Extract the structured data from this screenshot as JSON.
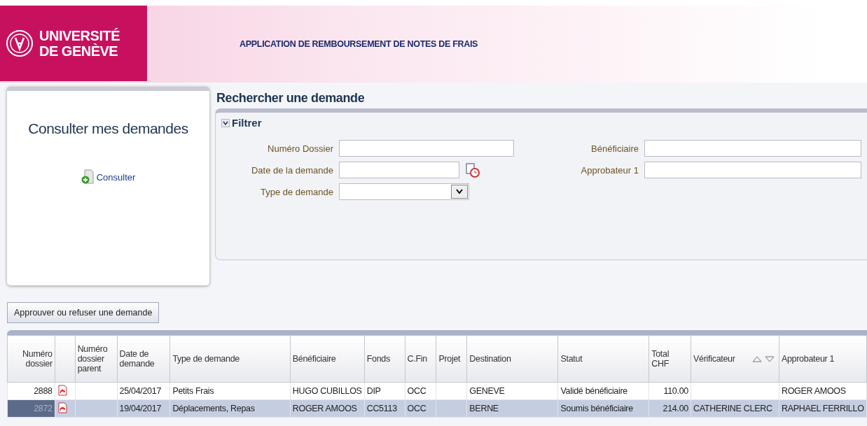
{
  "header": {
    "logo": [
      "UNIVERSITÉ",
      "DE GENÈVE"
    ],
    "app_title": "APPLICATION DE REMBOURSEMENT DE NOTES DE FRAIS"
  },
  "consult_card": {
    "title": "Consulter mes demandes",
    "link": "Consulter"
  },
  "search": {
    "title": "Rechercher une demande",
    "filter": {
      "label": "Filtrer",
      "expanded": true
    },
    "fields": [
      {
        "label": "Numéro Dossier",
        "kind": "text"
      },
      {
        "label": "Date de la demande",
        "kind": "date"
      },
      {
        "label": "Type de demande",
        "kind": "select"
      },
      {
        "label": "Bénéficiaire",
        "kind": "text"
      },
      {
        "label": "Approbateur 1",
        "kind": "text"
      }
    ]
  },
  "approve_button": "Approuver ou refuser une demande",
  "table": {
    "columns": [
      {
        "label": "Numéro dossier",
        "sortable": false
      },
      {
        "sortable": false
      },
      {
        "label": "Numéro dossier parent",
        "sortable": false
      },
      {
        "label": "Date de demande",
        "sortable": false
      },
      {
        "label": "Type de demande",
        "sortable": false
      },
      {
        "label": "Bénéficiaire",
        "sortable": false
      },
      {
        "label": "Fonds",
        "sortable": false
      },
      {
        "label": "C.Fin",
        "sortable": false
      },
      {
        "label": "Projet",
        "sortable": false
      },
      {
        "label": "Destination",
        "sortable": false
      },
      {
        "label": "Statut",
        "sortable": false
      },
      {
        "label": "Total CHF",
        "sortable": false
      },
      {
        "label": "Vérificateur",
        "sortable": true
      },
      {
        "label": "Approbateur 1",
        "sortable": false
      }
    ],
    "rows": [
      {
        "selected": false,
        "cells": [
          "2888",
          "",
          "",
          "25/04/2017",
          "Petits Frais",
          "HUGO CUBILLOS",
          "DIP",
          "OCC",
          "",
          "GENEVE",
          "Validé bénéficiaire",
          "110.00",
          "",
          "ROGER AMOOS"
        ]
      },
      {
        "selected": true,
        "cells": [
          "2872",
          "",
          "",
          "19/04/2017",
          "Déplacements, Repas",
          "ROGER AMOOS",
          "CC5113",
          "OCC",
          "",
          "BERNE",
          "Soumis bénéficiaire",
          "214.00",
          "CATHERINE CLERC",
          "RAPHAEL FERRILLO"
        ]
      }
    ]
  }
}
